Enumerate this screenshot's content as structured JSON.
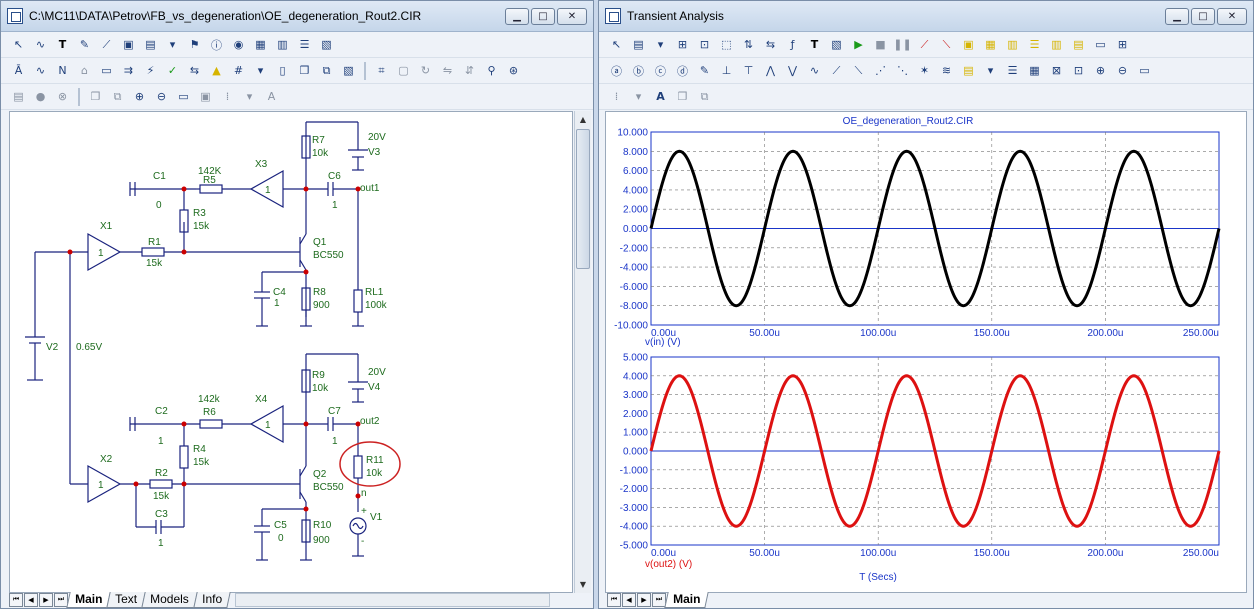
{
  "left_window": {
    "title": "C:\\MC11\\DATA\\Petrov\\FB_vs_degeneration\\OE_degeneration_Rout2.CIR",
    "tabs": [
      "Main",
      "Text",
      "Models",
      "Info"
    ],
    "active_tab": "Main"
  },
  "right_window": {
    "title": "Transient Analysis",
    "tabs": [
      "Main"
    ],
    "active_tab": "Main"
  },
  "schematic": {
    "labels": {
      "C1": "C1",
      "C1v": "0",
      "R5": "R5",
      "R5v": "142K",
      "X3": "X3",
      "X3v": "1",
      "C6": "C6",
      "C6v": "1",
      "out1": "out1",
      "R7": "R7",
      "R7v": "10k",
      "V3v": "20V",
      "V3": "V3",
      "R3": "R3",
      "R3v": "15k",
      "X1": "X1",
      "X1v": "1",
      "R1": "R1",
      "R1v": "15k",
      "Q1": "Q1",
      "Q1v": "BC550",
      "C4": "C4",
      "C4v": "1",
      "R8": "R8",
      "R8v": "900",
      "RL1": "RL1",
      "RL1v": "100k",
      "V2": "V2",
      "V2v": "0.65V",
      "R9": "R9",
      "R9v": "10k",
      "V4v": "20V",
      "V4": "V4",
      "C2": "C2",
      "C2v": "1",
      "R6": "R6",
      "R6v": "142k",
      "X4": "X4",
      "X4v": "1",
      "C7": "C7",
      "C7v": "1",
      "out2": "out2",
      "R4": "R4",
      "R4v": "15k",
      "R11": "R11",
      "R11v": "10k",
      "X2": "X2",
      "X2v": "1",
      "R2": "R2",
      "R2v": "15k",
      "Q2": "Q2",
      "Q2v": "BC550",
      "n": "n",
      "V1": "V1",
      "C3": "C3",
      "C3v": "1",
      "C5": "C5",
      "C5v": "0",
      "R10": "R10",
      "R10v": "900",
      "plus": "+",
      "minus": "-"
    }
  },
  "chart_data": [
    {
      "type": "line",
      "title": "OE_degeneration_Rout2.CIR",
      "ylabel": "v(in) (V)",
      "xlim": [
        0,
        250
      ],
      "ylim": [
        -10,
        10
      ],
      "x_ticks": [
        "0.00u",
        "50.00u",
        "100.00u",
        "150.00u",
        "200.00u",
        "250.00u"
      ],
      "y_ticks": [
        "10.000",
        "8.000",
        "6.000",
        "4.000",
        "2.000",
        "0.000",
        "-2.000",
        "-4.000",
        "-6.000",
        "-8.000",
        "-10.000"
      ],
      "series": [
        {
          "amplitude": 8,
          "frequency_per_u": 0.02,
          "phase": 0,
          "color": "#000000"
        }
      ],
      "grid": true
    },
    {
      "type": "line",
      "ylabel": "v(out2) (V)",
      "xlabel": "T (Secs)",
      "xlim": [
        0,
        250
      ],
      "ylim": [
        -5,
        5
      ],
      "x_ticks": [
        "0.00u",
        "50.00u",
        "100.00u",
        "150.00u",
        "200.00u",
        "250.00u"
      ],
      "y_ticks": [
        "5.000",
        "4.000",
        "3.000",
        "2.000",
        "1.000",
        "0.000",
        "-1.000",
        "-2.000",
        "-3.000",
        "-4.000",
        "-5.000"
      ],
      "series": [
        {
          "amplitude": 4,
          "frequency_per_u": 0.02,
          "phase": 0,
          "color": "#dd1111"
        }
      ],
      "grid": true
    }
  ],
  "colors": {
    "schematic_wire": "#1a237e",
    "node_dot": "#cc0000",
    "component": "#1a237e",
    "label": "#1e6b1e",
    "zero_line": "#1a35c8",
    "highlight_ring": "#cc2222"
  }
}
